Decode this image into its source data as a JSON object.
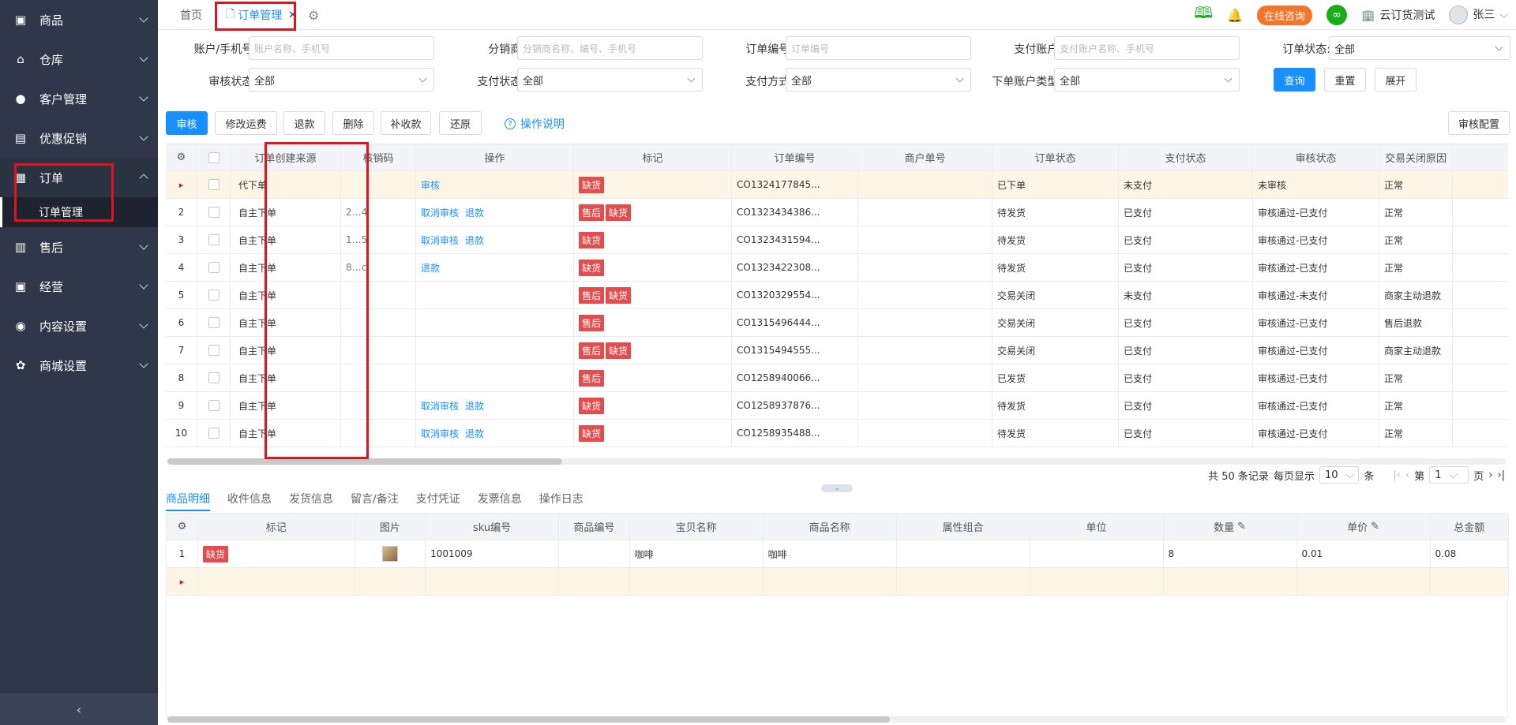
{
  "sidebar": {
    "items": [
      {
        "label": "商品",
        "icon": "goods-icon"
      },
      {
        "label": "仓库",
        "icon": "warehouse-icon"
      },
      {
        "label": "客户管理",
        "icon": "user-icon"
      },
      {
        "label": "优惠促销",
        "icon": "coupon-icon"
      },
      {
        "label": "订单",
        "icon": "order-icon"
      },
      {
        "label": "售后",
        "icon": "aftersale-icon"
      },
      {
        "label": "经营",
        "icon": "business-icon"
      },
      {
        "label": "内容设置",
        "icon": "eye-icon"
      },
      {
        "label": "商城设置",
        "icon": "gear-icon"
      }
    ],
    "active_sub": "订单管理",
    "collapse_glyph": "‹"
  },
  "tabs": {
    "home": "首页",
    "active": "订单管理",
    "close": "✕"
  },
  "header": {
    "consult": "在线咨询",
    "company": "云订货测试",
    "user": "张三"
  },
  "filters": {
    "row1": [
      {
        "label": "账户/手机号:",
        "placeholder": "账户名称、手机号"
      },
      {
        "label": "分销商:",
        "placeholder": "分销商名称、编号、手机号"
      },
      {
        "label": "订单编号:",
        "placeholder": "订单编号"
      },
      {
        "label": "支付账户:",
        "placeholder": "支付账户名称、手机号"
      },
      {
        "label": "订单状态:",
        "value": "全部"
      }
    ],
    "row2": [
      {
        "label": "审核状态:",
        "value": "全部"
      },
      {
        "label": "支付状态:",
        "value": "全部"
      },
      {
        "label": "支付方式:",
        "value": "全部"
      },
      {
        "label": "下单账户类型:",
        "value": "全部"
      }
    ],
    "search": "查询",
    "reset": "重置",
    "expand": "展开"
  },
  "toolbar": {
    "buttons": [
      "审核",
      "修改运费",
      "退款",
      "删除",
      "补收款",
      "还原"
    ],
    "help": "操作说明",
    "audit_config": "审核配置"
  },
  "orders": {
    "columns": [
      "订单创建来源",
      "核销码",
      "操作",
      "标记",
      "订单编号",
      "商户单号",
      "订单状态",
      "支付状态",
      "审核状态",
      "交易关闭原因"
    ],
    "rows": [
      {
        "no": "▸",
        "source": "代下单",
        "code": "",
        "ops": [
          "审核"
        ],
        "tags": [
          "缺货"
        ],
        "order_no": "CO1324177845...",
        "merchant_no": "",
        "status": "已下单",
        "pay": "未支付",
        "audit": "未审核",
        "close_reason": "正常"
      },
      {
        "no": "2",
        "source": "自主下单",
        "code": "2…4",
        "ops": [
          "取消审核",
          "退款"
        ],
        "tags": [
          "售后",
          "缺货"
        ],
        "order_no": "CO1323434386...",
        "merchant_no": "",
        "status": "待发货",
        "pay": "已支付",
        "audit": "审核通过-已支付",
        "close_reason": "正常"
      },
      {
        "no": "3",
        "source": "自主下单",
        "code": "1…5",
        "ops": [
          "取消审核",
          "退款"
        ],
        "tags": [
          "缺货"
        ],
        "order_no": "CO1323431594...",
        "merchant_no": "",
        "status": "待发货",
        "pay": "已支付",
        "audit": "审核通过-已支付",
        "close_reason": "正常"
      },
      {
        "no": "4",
        "source": "自主下单",
        "code": "8…c",
        "ops": [
          "退款"
        ],
        "tags": [
          "缺货"
        ],
        "order_no": "CO1323422308...",
        "merchant_no": "",
        "status": "待发货",
        "pay": "已支付",
        "audit": "审核通过-已支付",
        "close_reason": "正常"
      },
      {
        "no": "5",
        "source": "自主下单",
        "code": "",
        "ops": [],
        "tags": [
          "售后",
          "缺货"
        ],
        "order_no": "CO1320329554...",
        "merchant_no": "",
        "status": "交易关闭",
        "pay": "未支付",
        "audit": "审核通过-未支付",
        "close_reason": "商家主动退款"
      },
      {
        "no": "6",
        "source": "自主下单",
        "code": "",
        "ops": [],
        "tags": [
          "售后"
        ],
        "order_no": "CO1315496444...",
        "merchant_no": "",
        "status": "交易关闭",
        "pay": "已支付",
        "audit": "审核通过-已支付",
        "close_reason": "售后退款"
      },
      {
        "no": "7",
        "source": "自主下单",
        "code": "",
        "ops": [],
        "tags": [
          "售后",
          "缺货"
        ],
        "order_no": "CO1315494555...",
        "merchant_no": "",
        "status": "交易关闭",
        "pay": "已支付",
        "audit": "审核通过-已支付",
        "close_reason": "商家主动退款"
      },
      {
        "no": "8",
        "source": "自主下单",
        "code": "",
        "ops": [],
        "tags": [
          "售后"
        ],
        "order_no": "CO1258940066...",
        "merchant_no": "",
        "status": "已发货",
        "pay": "已支付",
        "audit": "审核通过-已支付",
        "close_reason": "正常"
      },
      {
        "no": "9",
        "source": "自主下单",
        "code": "",
        "ops": [
          "取消审核",
          "退款"
        ],
        "tags": [
          "缺货"
        ],
        "order_no": "CO1258937876...",
        "merchant_no": "",
        "status": "待发货",
        "pay": "已支付",
        "audit": "审核通过-已支付",
        "close_reason": "正常"
      },
      {
        "no": "10",
        "source": "自主下单",
        "code": "",
        "ops": [
          "取消审核",
          "退款"
        ],
        "tags": [
          "缺货"
        ],
        "order_no": "CO1258935488...",
        "merchant_no": "",
        "status": "待发货",
        "pay": "已支付",
        "audit": "审核通过-已支付",
        "close_reason": "正常"
      }
    ]
  },
  "pagination": {
    "total": "共 50 条记录",
    "per_page_label": "每页显示",
    "per_page": "10",
    "unit": "条",
    "page_label": "第",
    "page": "1",
    "page_unit": "页"
  },
  "detail_tabs": [
    "商品明细",
    "收件信息",
    "发货信息",
    "留言/备注",
    "支付凭证",
    "发票信息",
    "操作日志"
  ],
  "items": {
    "columns": [
      "标记",
      "图片",
      "sku编号",
      "商品编号",
      "宝贝名称",
      "商品名称",
      "属性组合",
      "单位",
      "数量",
      "单价",
      "总金额"
    ],
    "rows": [
      {
        "no": "1",
        "tag": "缺货",
        "sku": "1001009",
        "goods_no": "",
        "item_name": "咖啡",
        "product_name": "咖啡",
        "attrs": "",
        "unit": "",
        "qty": "8",
        "price": "0.01",
        "total": "0.08"
      }
    ]
  }
}
